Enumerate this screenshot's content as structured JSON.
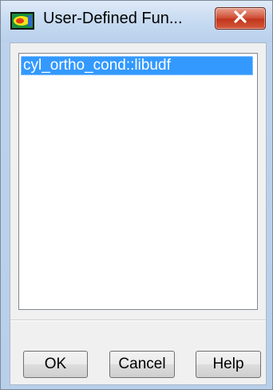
{
  "window": {
    "title": "User-Defined Fun...",
    "icon": "fluent-app-icon",
    "close_icon": "close-x-icon"
  },
  "list": {
    "items": [
      {
        "label": "cyl_ortho_cond::libudf",
        "selected": true
      }
    ]
  },
  "buttons": {
    "ok_label": "OK",
    "cancel_label": "Cancel",
    "help_label": "Help"
  },
  "colors": {
    "selection": "#3399ff",
    "close_button": "#c9452a",
    "title_bar": "#c6daf1"
  }
}
